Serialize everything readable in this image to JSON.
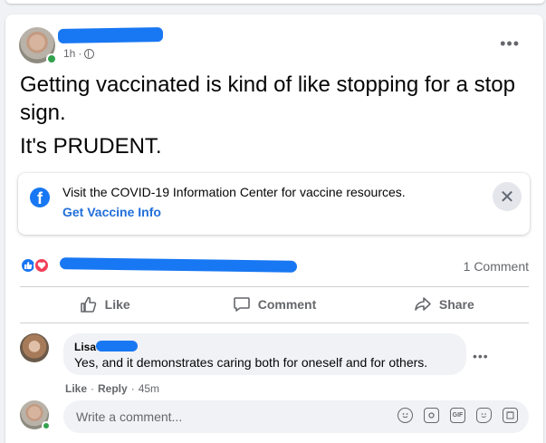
{
  "post": {
    "time": "1h",
    "separator": "·",
    "text_line1": "Getting vaccinated is kind of like stopping for a stop sign.",
    "text_line2": "It's PRUDENT.",
    "more_label": "•••"
  },
  "info_banner": {
    "text": "Visit the COVID-19 Information Center for vaccine resources.",
    "link": "Get Vaccine Info",
    "close": "✕",
    "logo_letter": "f"
  },
  "stats": {
    "comments": "1 Comment"
  },
  "actions": {
    "like": "Like",
    "comment": "Comment",
    "share": "Share"
  },
  "comment": {
    "name": "Lisa",
    "text": "Yes, and it demonstrates caring both for oneself and for others.",
    "like": "Like",
    "reply": "Reply",
    "time": "45m",
    "separator": "·",
    "more_label": "•••"
  },
  "composer": {
    "placeholder": "Write a comment...",
    "gif_label": "GIF"
  },
  "colors": {
    "accent": "#1877f2",
    "online": "#31a24c",
    "love": "#f33e58"
  }
}
